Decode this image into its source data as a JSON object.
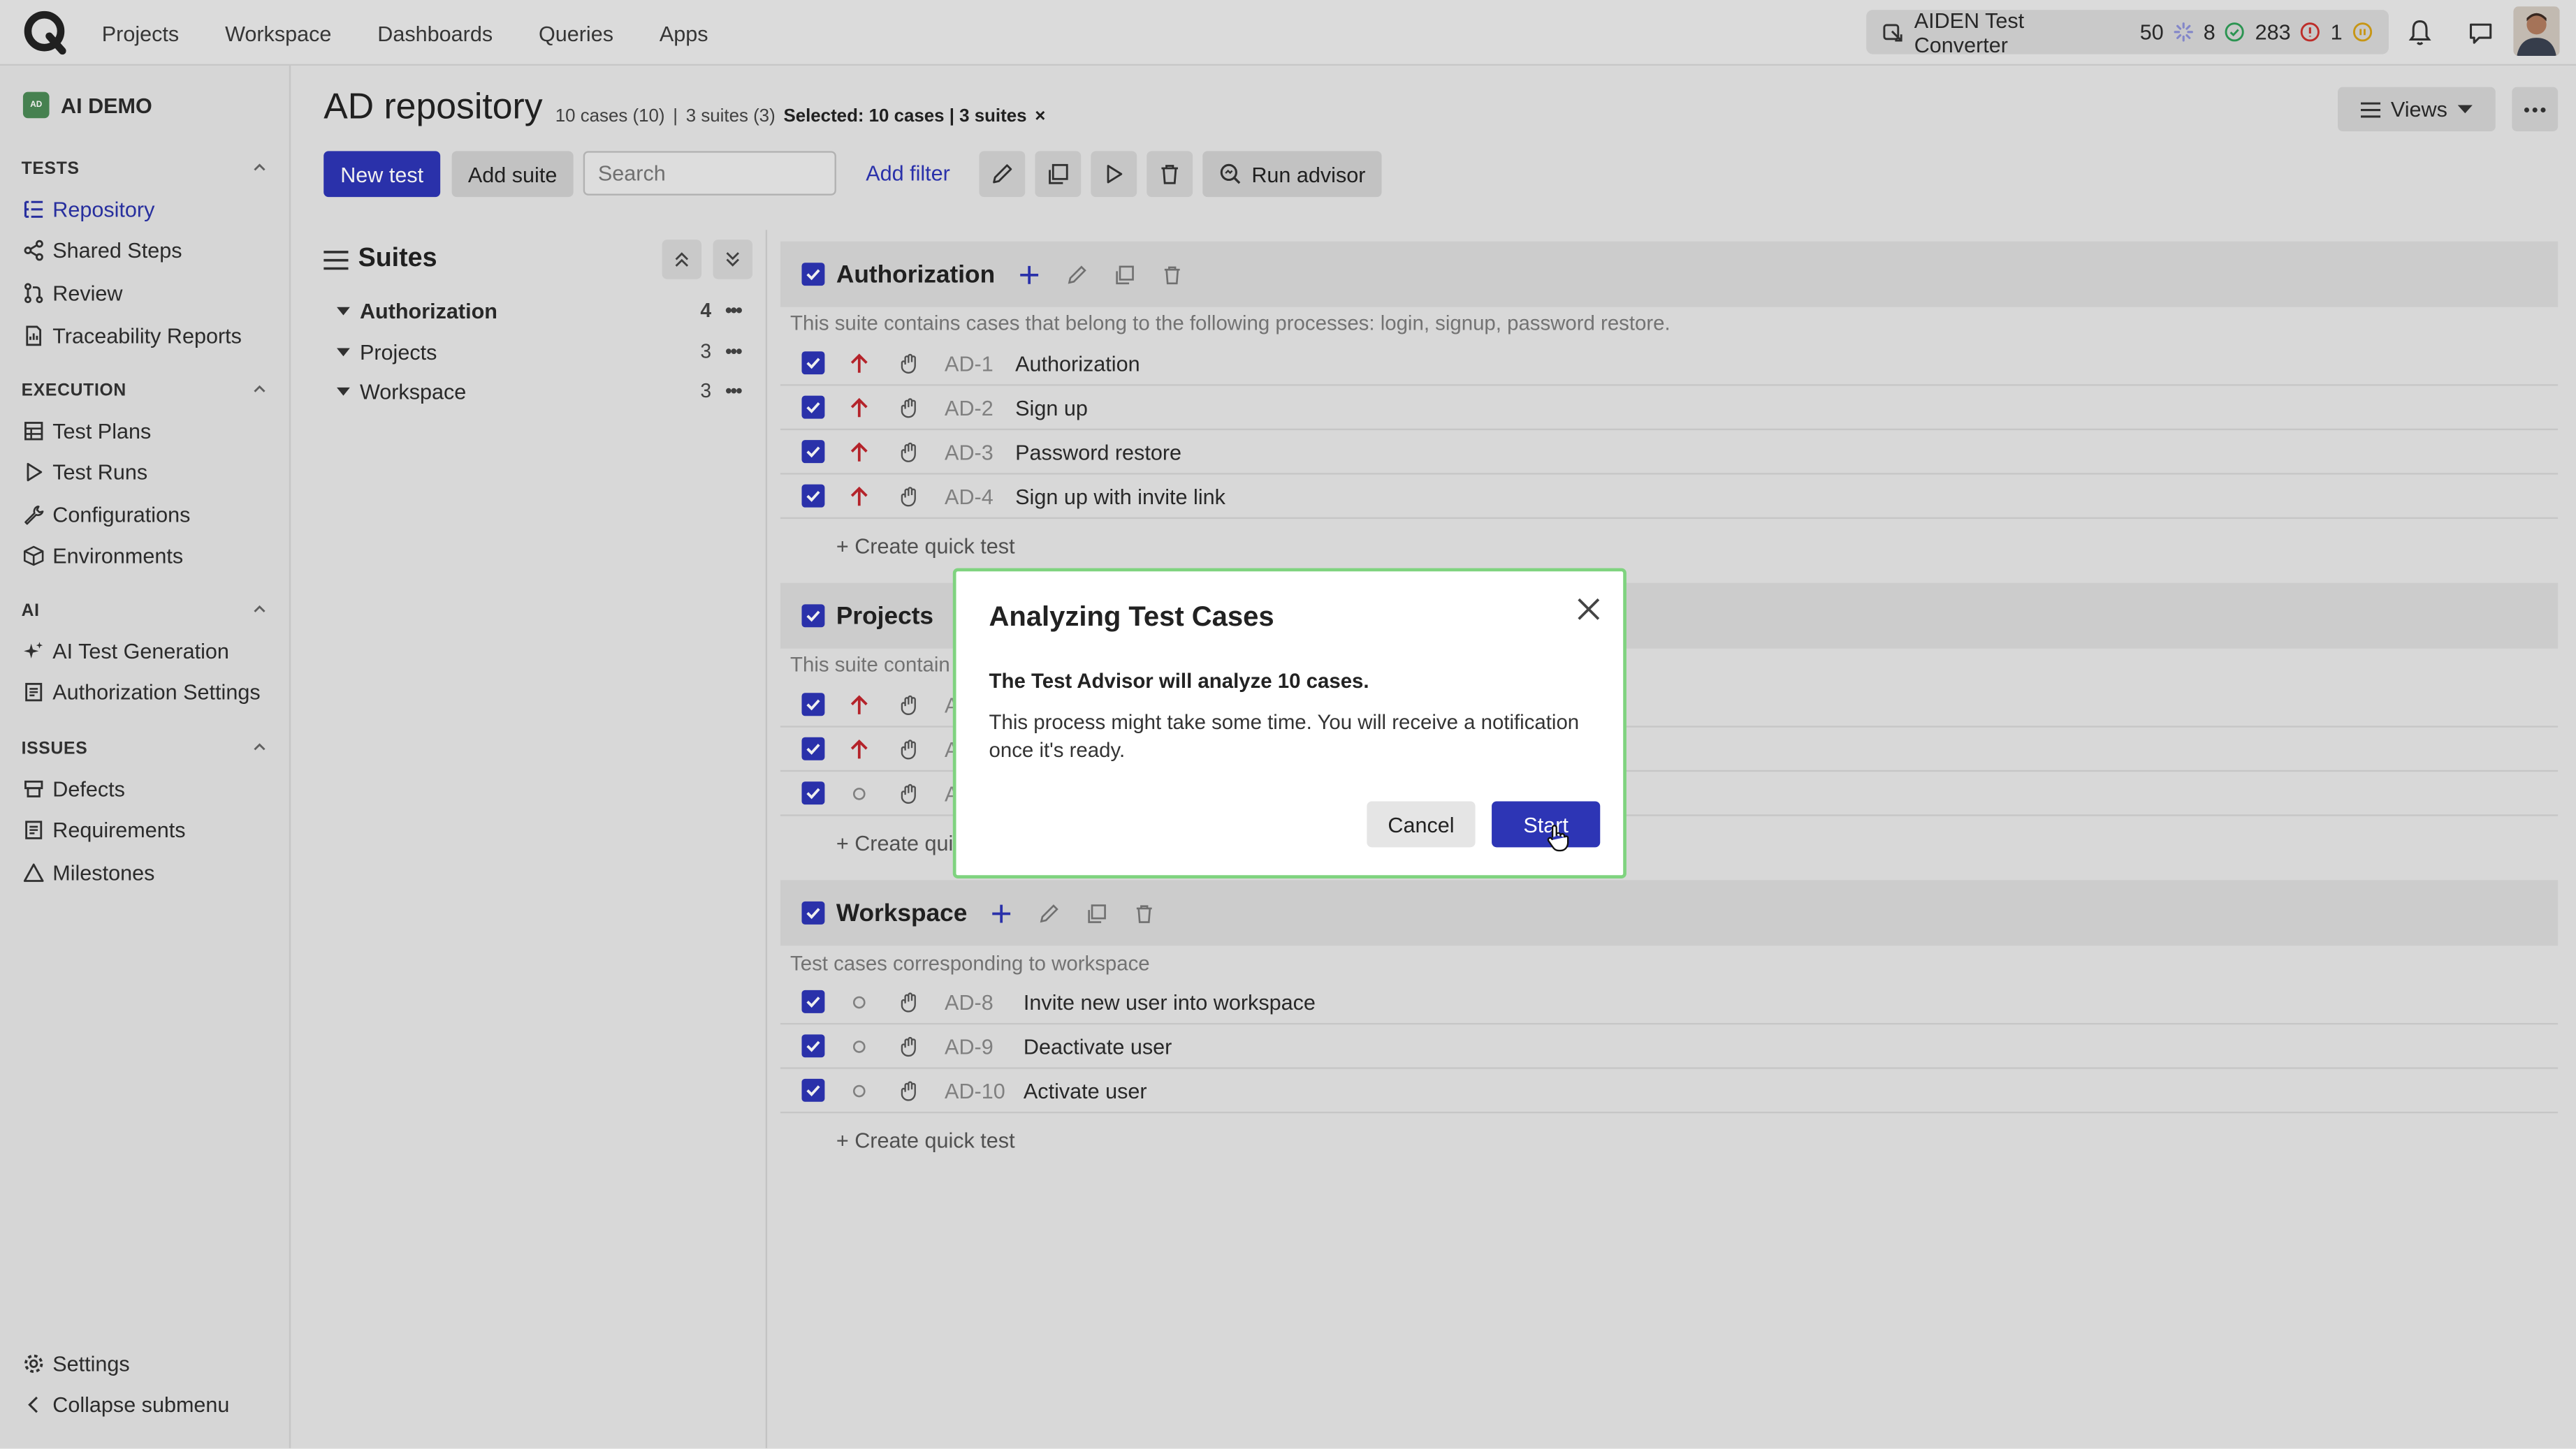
{
  "topnav": {
    "items": [
      "Projects",
      "Workspace",
      "Dashboards",
      "Queries",
      "Apps"
    ],
    "aiden": {
      "label": "AIDEN Test Converter",
      "count_processing": "50",
      "count_passed": "8",
      "count_failed": "283",
      "count_pending": "1"
    }
  },
  "sidebar": {
    "project": "AI DEMO",
    "project_badge": "AD",
    "sections": [
      {
        "title": "TESTS",
        "items": [
          "Repository",
          "Shared Steps",
          "Review",
          "Traceability Reports"
        ]
      },
      {
        "title": "EXECUTION",
        "items": [
          "Test Plans",
          "Test Runs",
          "Configurations",
          "Environments"
        ]
      },
      {
        "title": "AI",
        "items": [
          "AI Test Generation",
          "Authorization Settings"
        ]
      },
      {
        "title": "ISSUES",
        "items": [
          "Defects",
          "Requirements",
          "Milestones"
        ]
      }
    ],
    "settings": "Settings",
    "collapse": "Collapse submenu"
  },
  "header": {
    "title": "AD repository",
    "meta_cases": "10 cases (10)",
    "meta_sep": "|",
    "meta_suites": "3 suites (3)",
    "meta_selected": "Selected: 10 cases | 3 suites",
    "meta_clear": "×"
  },
  "toolbar": {
    "new_test": "New test",
    "add_suite": "Add suite",
    "search_placeholder": "Search",
    "add_filter": "Add filter",
    "run_advisor": "Run advisor",
    "views": "Views"
  },
  "suites_panel": {
    "title": "Suites",
    "items": [
      {
        "name": "Authorization",
        "count": "4"
      },
      {
        "name": "Projects",
        "count": "3"
      },
      {
        "name": "Workspace",
        "count": "3"
      }
    ]
  },
  "suites": {
    "authorization": {
      "name": "Authorization",
      "description": "This suite contains cases that belong to the following processes: login, signup, password restore.",
      "cases": [
        {
          "id": "AD-1",
          "title": "Authorization",
          "priority": "high"
        },
        {
          "id": "AD-2",
          "title": "Sign up",
          "priority": "high"
        },
        {
          "id": "AD-3",
          "title": "Password restore",
          "priority": "high"
        },
        {
          "id": "AD-4",
          "title": "Sign up with invite link",
          "priority": "high"
        }
      ],
      "quick": "+ Create quick test"
    },
    "projects": {
      "name": "Projects",
      "description": "This suite contain",
      "cases": [
        {
          "id": "A",
          "title": "",
          "priority": "high"
        },
        {
          "id": "A",
          "title": "",
          "priority": "high"
        },
        {
          "id": "A",
          "title": "",
          "priority": "none"
        }
      ],
      "quick": "+ Create quic"
    },
    "workspace": {
      "name": "Workspace",
      "description": "Test cases corresponding to workspace",
      "cases": [
        {
          "id": "AD-8",
          "title": "Invite new user into workspace",
          "priority": "none"
        },
        {
          "id": "AD-9",
          "title": "Deactivate user",
          "priority": "none"
        },
        {
          "id": "AD-10",
          "title": "Activate user",
          "priority": "none"
        }
      ],
      "quick": "+ Create quick test"
    }
  },
  "modal": {
    "title": "Analyzing Test Cases",
    "line1": "The Test Advisor will analyze 10 cases.",
    "line2": "This process might take some time. You will receive a notification once it's ready.",
    "cancel": "Cancel",
    "start": "Start"
  },
  "colors": {
    "accent": "#2d35b5",
    "priority_high": "#c0262d",
    "modal_border": "#7fd37f"
  }
}
